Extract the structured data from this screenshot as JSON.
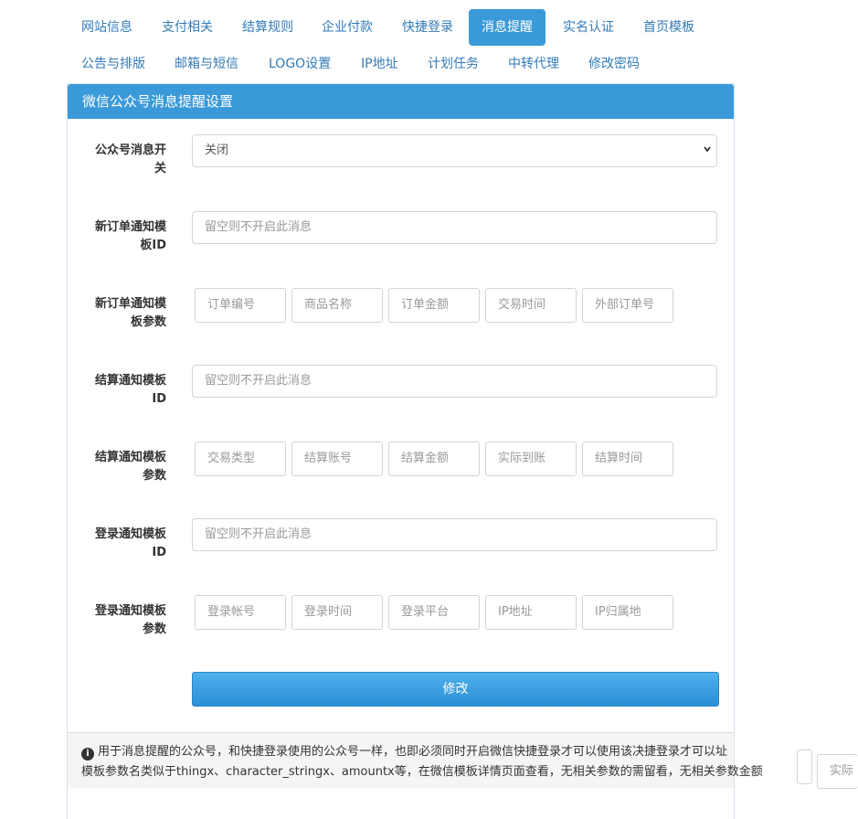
{
  "nav": {
    "tabs": [
      "网站信息",
      "支付相关",
      "结算规则",
      "企业付款",
      "快捷登录",
      "消息提醒",
      "实名认证",
      "首页模板",
      "公告与排版",
      "邮箱与短信",
      "LOGO设置",
      "IP地址",
      "计划任务",
      "中转代理",
      "修改密码"
    ],
    "active": "消息提醒"
  },
  "panel": {
    "title": "微信公众号消息提醒设置",
    "switch_label_1": "公众号消息开",
    "switch_label_2": "关",
    "switch_value": "关闭",
    "order_tpl_label_1": "新订单通知模",
    "order_tpl_label_2": "板ID",
    "order_tpl_placeholder": "留空则不开启此消息",
    "order_params_label_1": "新订单通知模",
    "order_params_label_2": "板参数",
    "order_params": [
      "订单编号",
      "商品名称",
      "订单金额",
      "交易时间",
      "外部订单号"
    ],
    "settle_tpl_label_1": "结算通知模板",
    "settle_tpl_label_2": "ID",
    "settle_tpl_placeholder": "留空则不开启此消息",
    "settle_params_label_1": "结算通知模板",
    "settle_params_label_2": "参数",
    "settle_params": [
      "交易类型",
      "结算账号",
      "结算金额",
      "实际到账",
      "结算时间"
    ],
    "login_tpl_label_1": "登录通知模板",
    "login_tpl_label_2": "ID",
    "login_tpl_placeholder": "留空则不开启此消息",
    "login_params_label_1": "登录通知模板",
    "login_params_label_2": "参数",
    "login_params": [
      "登录帐号",
      "登录时间",
      "登录平台",
      "IP地址",
      "IP归属地"
    ],
    "submit_label": "修改"
  },
  "footer": {
    "line1": "用于消息提醒的公众号，和快捷登录使用的公众号一样，也即必须同时开启微信快捷登录才可以使用该决捷登录才可以址",
    "line2": "模板参数名类似于thingx、character_stringx、amountx等，在微信模板详情页面查看，无相关参数的需留看，无相关参数金额",
    "overflow_chip": "实际到"
  },
  "colors": {
    "accent": "#3a9ad9",
    "link": "#337ab7"
  }
}
